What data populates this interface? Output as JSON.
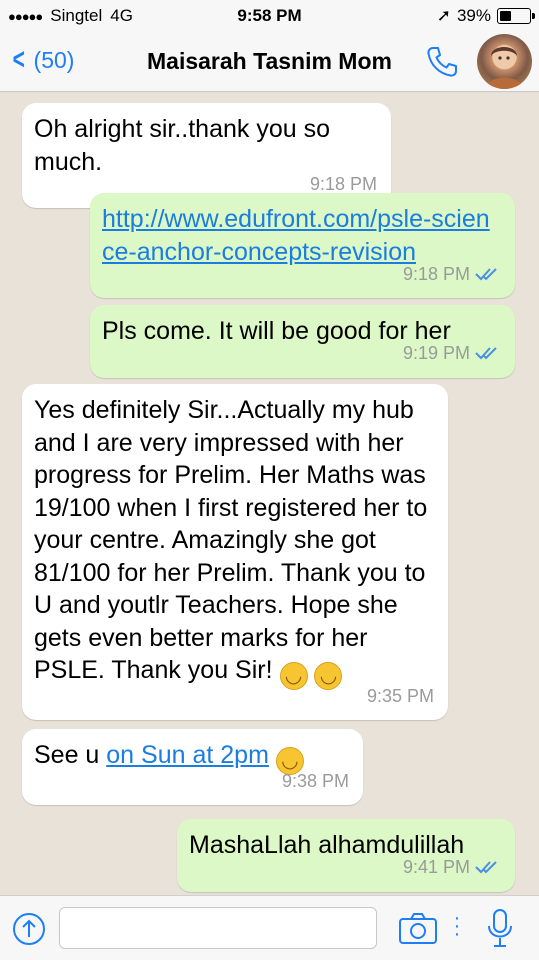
{
  "status_bar": {
    "signal": "●●●●●",
    "carrier": "Singtel",
    "network": "4G",
    "time": "9:58 PM",
    "location_arrow": "➚",
    "battery_text": "39%",
    "battery_level": 0.39
  },
  "nav": {
    "back_label": "(50)",
    "contact_name": "Maisarah Tasnim Mom",
    "call_icon": "phone-icon",
    "avatar_icon": "contact-avatar"
  },
  "messages": [
    {
      "dir": "in",
      "text": "Oh alright sir..thank you so much.",
      "time": "9:18 PM"
    },
    {
      "dir": "out",
      "link": "http://www.edufront.com/psle-science-anchor-concepts-revision",
      "time": "9:18 PM",
      "status": "read"
    },
    {
      "dir": "out",
      "text": "Pls come. It will be good for her",
      "time": "9:19 PM",
      "status": "read"
    },
    {
      "dir": "in",
      "text": "Yes definitely Sir...Actually my hub and I are very impressed with her progress for Prelim. Her Maths was 19/100 when I first registered her to your centre. Amazingly she got 81/100 for her Prelim. Thank you to U and youtlr Teachers. Hope she gets even better marks for her PSLE. Thank you Sir!",
      "emoji": "😊😊",
      "time": "9:35 PM"
    },
    {
      "dir": "in",
      "text_prefix": "See u ",
      "link": "on Sun at 2pm",
      "emoji": "😊",
      "time": "9:38 PM"
    },
    {
      "dir": "out",
      "text": "MashaLlah alhamdulillah",
      "time": "9:41 PM",
      "status": "read"
    }
  ],
  "input_bar": {
    "placeholder": "",
    "attach_icon": "upload-icon",
    "camera_icon": "camera-icon",
    "more_icon": "more-dots-icon",
    "mic_icon": "microphone-icon"
  },
  "colors": {
    "accent": "#1e7ef7",
    "outgoing_bubble": "#dcf8c6",
    "incoming_bubble": "#ffffff",
    "chat_bg": "#e9e2d8",
    "link": "#1a7de0"
  }
}
